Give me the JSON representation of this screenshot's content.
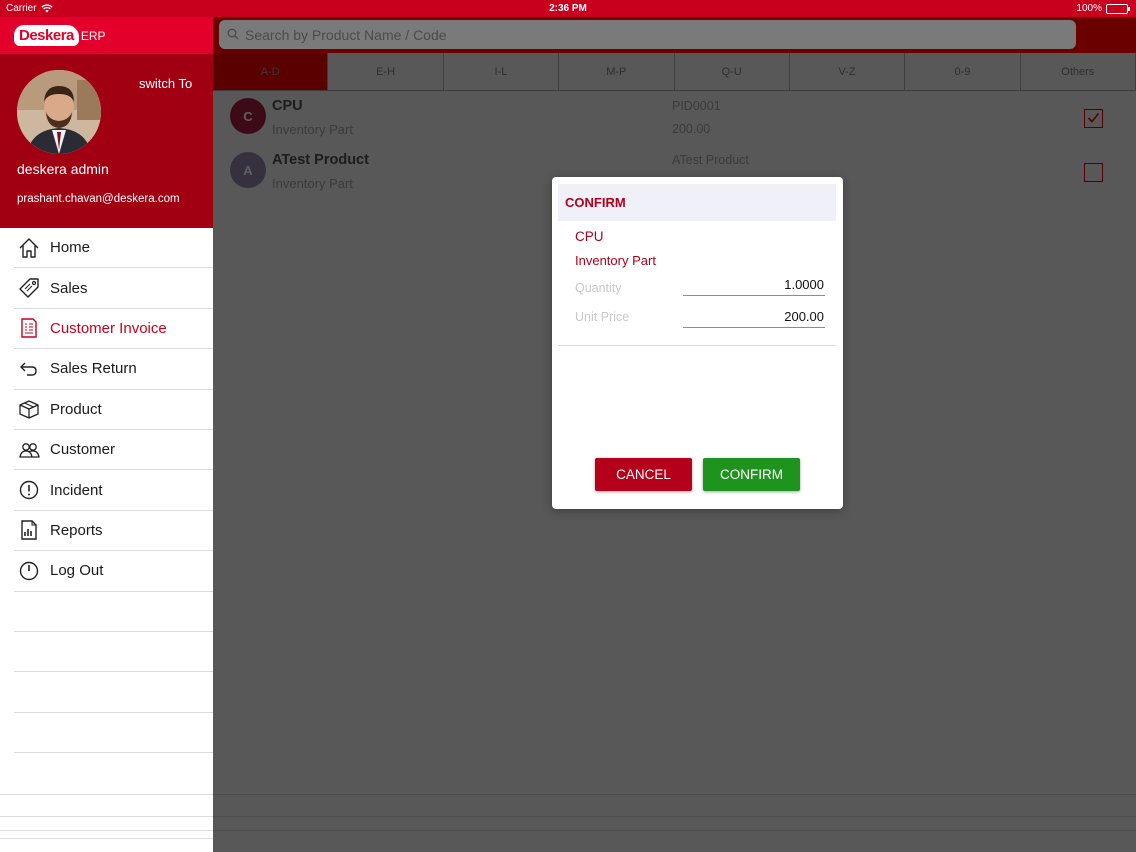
{
  "status_bar": {
    "carrier": "Carrier",
    "time": "2:36 PM",
    "battery": "100%"
  },
  "brand": {
    "logo_main": "Deskera",
    "logo_suffix": "ERP"
  },
  "profile": {
    "switch_label": "switch To",
    "name": "deskera admin",
    "email": "prashant.chavan@deskera.com"
  },
  "menu": [
    {
      "label": "Home",
      "icon": "home-icon"
    },
    {
      "label": "Sales",
      "icon": "tag-icon"
    },
    {
      "label": "Customer Invoice",
      "icon": "invoice-icon",
      "active": true
    },
    {
      "label": "Sales Return",
      "icon": "return-arrow-icon"
    },
    {
      "label": "Product",
      "icon": "box-icon"
    },
    {
      "label": "Customer",
      "icon": "people-icon"
    },
    {
      "label": "Incident",
      "icon": "alert-circle-icon"
    },
    {
      "label": "Reports",
      "icon": "report-icon"
    },
    {
      "label": "Log Out",
      "icon": "power-icon"
    }
  ],
  "search": {
    "placeholder": "Search by Product Name / Code"
  },
  "tabs": [
    "A-D",
    "E-H",
    "I-L",
    "M-P",
    "Q-U",
    "V-Z",
    "0-9",
    "Others"
  ],
  "products": [
    {
      "initial": "C",
      "name": "CPU",
      "type": "Inventory Part",
      "code": "PID0001",
      "price": "200.00",
      "checked": true
    },
    {
      "initial": "A",
      "name": "ATest Product",
      "type": "Inventory Part",
      "code": "ATest Product",
      "price": "",
      "checked": false
    }
  ],
  "dialog": {
    "title": "CONFIRM",
    "product_name": "CPU",
    "product_type": "Inventory Part",
    "quantity_label": "Quantity",
    "quantity_value": "1.0000",
    "unit_price_label": "Unit Price",
    "unit_price_value": "200.00",
    "cancel_label": "CANCEL",
    "confirm_label": "CONFIRM"
  },
  "colors": {
    "brand_red": "#e3002b",
    "profile_bg": "#a10012",
    "confirm_green": "#1e931e",
    "cancel_red": "#b5001b"
  }
}
